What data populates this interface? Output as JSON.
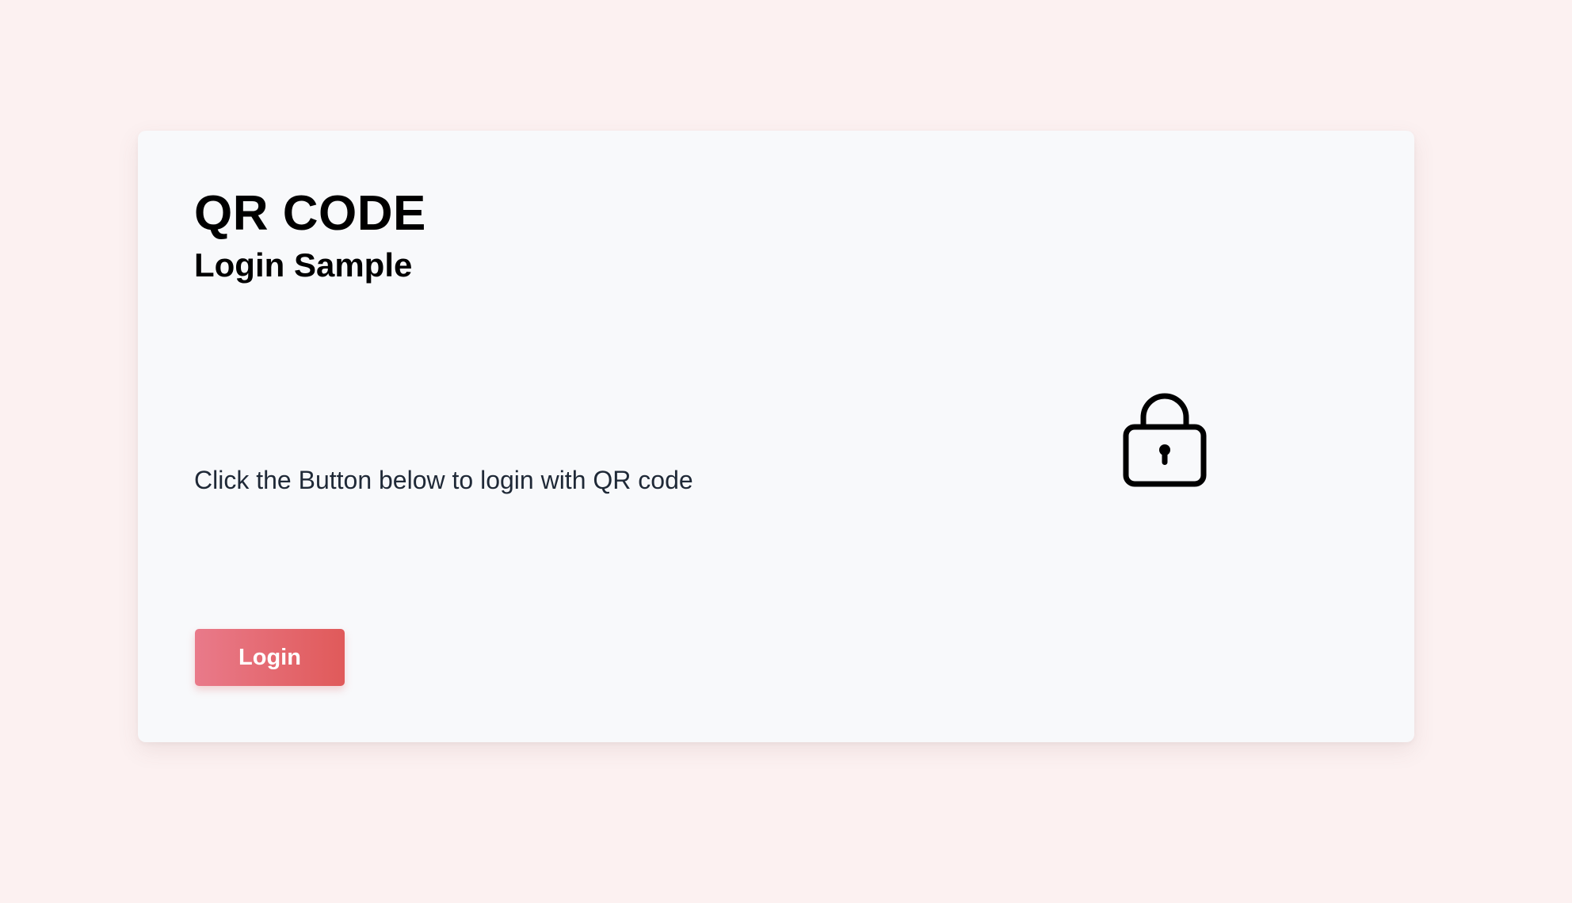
{
  "colors": {
    "page_background": "#fcf1f1",
    "card_background": "#f8f9fb",
    "button_gradient_start": "#e97a8a",
    "button_gradient_end": "#e05a5a",
    "text_primary": "#000000",
    "text_secondary": "#1f2937"
  },
  "card": {
    "title": "QR CODE",
    "subtitle": "Login Sample",
    "instruction": "Click the Button below to login with QR code",
    "icon": "lock-icon",
    "login_button_label": "Login"
  }
}
